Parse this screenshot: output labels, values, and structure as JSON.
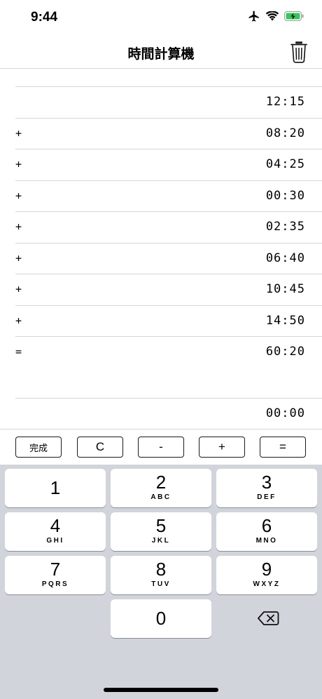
{
  "status_bar": {
    "time": "9:44",
    "icons": [
      "airplane-icon",
      "wifi-icon",
      "battery-charging-icon"
    ],
    "battery_color": "#34c759"
  },
  "nav": {
    "title": "時間計算機",
    "trash_icon": "trash-icon"
  },
  "rows": [
    {
      "op": "",
      "value": "12:15"
    },
    {
      "op": "+",
      "value": "08:20"
    },
    {
      "op": "+",
      "value": "04:25"
    },
    {
      "op": "+",
      "value": "00:30"
    },
    {
      "op": "+",
      "value": "02:35"
    },
    {
      "op": "+",
      "value": "06:40"
    },
    {
      "op": "+",
      "value": "10:45"
    },
    {
      "op": "+",
      "value": "14:50"
    },
    {
      "op": "=",
      "value": "60:20"
    }
  ],
  "input": {
    "value": "00:00"
  },
  "op_buttons": {
    "done": "完成",
    "clear": "C",
    "minus": "-",
    "plus": "+",
    "equals": "="
  },
  "keypad": {
    "k1": {
      "num": "1",
      "letters": ""
    },
    "k2": {
      "num": "2",
      "letters": "ABC"
    },
    "k3": {
      "num": "3",
      "letters": "DEF"
    },
    "k4": {
      "num": "4",
      "letters": "GHI"
    },
    "k5": {
      "num": "5",
      "letters": "JKL"
    },
    "k6": {
      "num": "6",
      "letters": "MNO"
    },
    "k7": {
      "num": "7",
      "letters": "PQRS"
    },
    "k8": {
      "num": "8",
      "letters": "TUV"
    },
    "k9": {
      "num": "9",
      "letters": "WXYZ"
    },
    "k0": {
      "num": "0",
      "letters": ""
    },
    "delete_icon": "delete-backspace-icon"
  }
}
